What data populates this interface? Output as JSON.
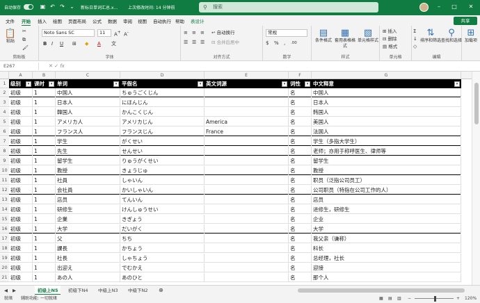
{
  "title_bar": {
    "autosave_label": "自动保存",
    "autosave_state": "off",
    "file_title": "新标日单词汇总.x...",
    "last_modified": "上次修改时间: 14 分钟前",
    "search_placeholder": "搜索"
  },
  "ribbon_tabs": [
    "文件",
    "开始",
    "插入",
    "绘图",
    "页面布局",
    "公式",
    "数据",
    "审阅",
    "视图",
    "自动执行",
    "帮助",
    "表设计"
  ],
  "active_tab": "开始",
  "share_label": "共享",
  "ribbon": {
    "clipboard": {
      "paste": "粘贴",
      "label": "剪贴板"
    },
    "font": {
      "name": "Noto Sans SC",
      "size": "11",
      "label": "字体"
    },
    "alignment": {
      "wrap": "自动换行",
      "merge": "合并后居中",
      "label": "对齐方式"
    },
    "number": {
      "format": "常规",
      "label": "数字"
    },
    "styles": {
      "conditional": "条件格式",
      "table": "套用表格格式",
      "cell_styles": "单元格样式",
      "label": "样式"
    },
    "cells": {
      "insert": "插入",
      "delete": "删除",
      "format": "格式",
      "label": "单元格"
    },
    "editing": {
      "sort": "排序和筛选",
      "find": "查找和选择",
      "label": "编辑"
    },
    "addins": {
      "load": "加载项"
    }
  },
  "formula_bar": {
    "name_box": "E267",
    "fx": "fx",
    "formula": ""
  },
  "columns": [
    "A",
    "B",
    "C",
    "D",
    "E",
    "F",
    "G"
  ],
  "table": {
    "headers": [
      "级别",
      "课时",
      "单词",
      "平假名",
      "英文词源",
      "词性",
      "中文释意"
    ],
    "rows": [
      {
        "n": "2",
        "c": [
          "初级",
          "1",
          "中国人",
          "ちゅうごくじん",
          "",
          "名",
          "中国人"
        ],
        "thick": true
      },
      {
        "n": "3",
        "c": [
          "初级",
          "1",
          "日本人",
          "にほんじん",
          "",
          "名",
          "日本人"
        ],
        "thick": false
      },
      {
        "n": "4",
        "c": [
          "初级",
          "1",
          "韓国人",
          "かんこくじん",
          "",
          "名",
          "韩国人"
        ],
        "thick": false
      },
      {
        "n": "5",
        "c": [
          "初级",
          "1",
          "アメリカ人",
          "アメリカじん",
          "America",
          "名",
          "美国人"
        ],
        "thick": false
      },
      {
        "n": "6",
        "c": [
          "初级",
          "1",
          "フランス人",
          "フランスじん",
          "France",
          "名",
          "法国人"
        ],
        "thick": true
      },
      {
        "n": "7",
        "c": [
          "初级",
          "1",
          "学生",
          "がくせい",
          "",
          "名",
          "学生（多指大学生）"
        ],
        "thick": true
      },
      {
        "n": "8",
        "c": [
          "初级",
          "1",
          "先生",
          "せんせい",
          "",
          "名",
          "老师；亦用于称呼医生、律师等"
        ],
        "thick": true
      },
      {
        "n": "9",
        "c": [
          "初级",
          "1",
          "留学生",
          "りゅうがくせい",
          "",
          "名",
          "留学生"
        ],
        "thick": false
      },
      {
        "n": "10",
        "c": [
          "初级",
          "1",
          "教授",
          "きょうじゅ",
          "",
          "名",
          "教授"
        ],
        "thick": true
      },
      {
        "n": "11",
        "c": [
          "初级",
          "1",
          "社員",
          "しゃいん",
          "",
          "名",
          "职员（泛指公司员工）"
        ],
        "thick": false
      },
      {
        "n": "12",
        "c": [
          "初级",
          "1",
          "会社員",
          "かいしゃいん",
          "",
          "名",
          "公司职员（特指在公司工作的人）"
        ],
        "thick": true
      },
      {
        "n": "13",
        "c": [
          "初级",
          "1",
          "店员",
          "てんいん",
          "",
          "名",
          "店员"
        ],
        "thick": false
      },
      {
        "n": "14",
        "c": [
          "初级",
          "1",
          "研修生",
          "けんしゅうせい",
          "",
          "名",
          "进修生，研修生"
        ],
        "thick": false
      },
      {
        "n": "15",
        "c": [
          "初级",
          "1",
          "企業",
          "きぎょう",
          "",
          "名",
          "企业"
        ],
        "thick": false
      },
      {
        "n": "16",
        "c": [
          "初级",
          "1",
          "大学",
          "だいがく",
          "",
          "名",
          "大学"
        ],
        "thick": true
      },
      {
        "n": "17",
        "c": [
          "初级",
          "1",
          "父",
          "ちち",
          "",
          "名",
          "我父亲（谦称）"
        ],
        "thick": false
      },
      {
        "n": "18",
        "c": [
          "初级",
          "1",
          "課長",
          "かちょう",
          "",
          "名",
          "科长"
        ],
        "thick": false
      },
      {
        "n": "19",
        "c": [
          "初级",
          "1",
          "社長",
          "しゃちょう",
          "",
          "名",
          "总经理，社长"
        ],
        "thick": false
      },
      {
        "n": "20",
        "c": [
          "初级",
          "1",
          "出迎え",
          "でむかえ",
          "",
          "名",
          "迎接"
        ],
        "thick": false
      },
      {
        "n": "21",
        "c": [
          "初级",
          "1",
          "あの人",
          "あのひと",
          "",
          "名",
          "那个人"
        ],
        "thick": false
      }
    ]
  },
  "sheet_tabs": [
    "初级上N5",
    "初级下N4",
    "中级上N3",
    "中级下N2"
  ],
  "active_sheet": "初级上N5",
  "status": {
    "ready": "就绪",
    "accessibility": "辅助功能: 一切就绪",
    "zoom": "120%"
  },
  "colors": {
    "accent": "#107c41",
    "header_fill": "#000000"
  }
}
